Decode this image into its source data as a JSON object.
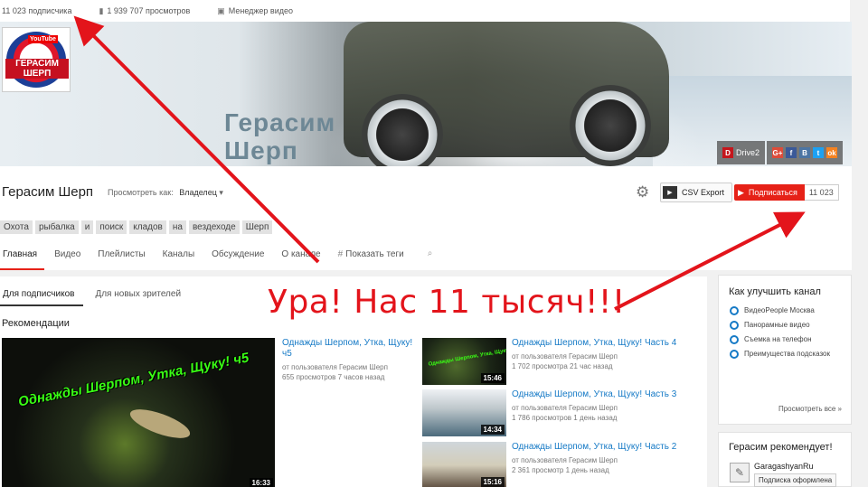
{
  "stats": {
    "subscribers": "11 023 подписчика",
    "views": "1 939 707 просмотров",
    "video_manager": "Менеджер видео"
  },
  "banner": {
    "title_line1": "Герасим",
    "title_line2": "Шерп",
    "logo_text": "ГЕРАСИМ ШЕРП",
    "logo_yt": "YouTube",
    "drive2_label": "Drive2",
    "social_icons": [
      "G+",
      "f",
      "B",
      "t",
      "ok"
    ]
  },
  "channel": {
    "name": "Герасим Шерп",
    "view_as_label": "Просмотреть как:",
    "view_as_value": "Владелец",
    "csv_label": "CSV Export",
    "subscribe_label": "Подписаться",
    "subscribe_count": "11 023",
    "tags": [
      "Охота",
      "рыбалка",
      "и",
      "поиск",
      "кладов",
      "на",
      "вездеходе",
      "Шерп"
    ],
    "tabs": [
      "Главная",
      "Видео",
      "Плейлисты",
      "Каналы",
      "Обсуждение",
      "О канале"
    ],
    "show_tags": "Показать теги"
  },
  "main": {
    "subtabs": [
      "Для подписчиков",
      "Для новых зрителей"
    ],
    "recommendations_title": "Рекомендации",
    "featured": {
      "overlay_text": "Однажды Шерпом, Утка, Щуку! ч5",
      "title": "Однажды Шерпом, Утка, Щуку! ч5",
      "author": "от пользователя Герасим Шерп",
      "meta": "655 просмотров   7 часов назад",
      "duration": "16:33"
    },
    "videos": [
      {
        "title": "Однажды Шерпом, Утка, Щуку! Часть 4",
        "author": "от пользователя Герасим Шерп",
        "meta": "1 702 просмотра   21 час назад",
        "duration": "15:46"
      },
      {
        "title": "Однажды Шерпом, Утка, Щуку! Часть 3",
        "author": "от пользователя Герасим Шерп",
        "meta": "1 786 просмотров   1 день назад",
        "duration": "14:34"
      },
      {
        "title": "Однажды Шерпом, Утка, Щуку! Часть 2",
        "author": "от пользователя Герасим Шерп",
        "meta": "2 361 просмотр   1 день назад",
        "duration": "15:16"
      }
    ]
  },
  "annotation": {
    "text": "Ура! Нас 11 тысяч!!!",
    "color": "#e3141b"
  },
  "sidebar": {
    "improve_title": "Как улучшить канал",
    "improve_items": [
      "ВидеоPeople Москва",
      "Панорамные видео",
      "Съемка на телефон",
      "Преимущества подсказок"
    ],
    "see_all": "Просмотреть все  »",
    "recommends_title": "Герасим рекомендует!",
    "rec_channel": "GaragashyanRu",
    "rec_button": "Подписка оформлена"
  },
  "colors": {
    "accent_red": "#e62117",
    "link_blue": "#167ac6"
  }
}
